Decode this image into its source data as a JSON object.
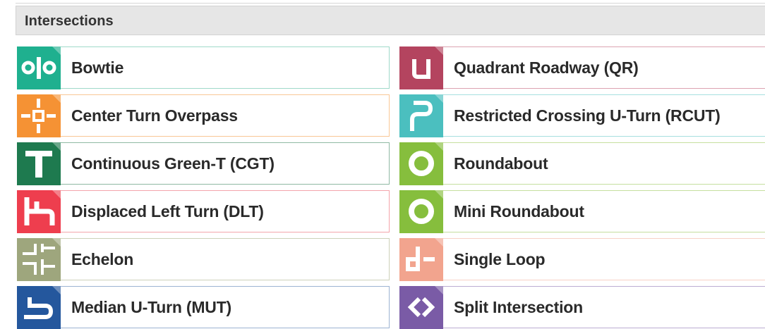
{
  "section": {
    "title": "Intersections"
  },
  "colors": {
    "bowtie": "#1fb08f",
    "center_turn_overpass": "#f59234",
    "continuous_green_t": "#1e7a4f",
    "displaced_left_turn": "#ee3e4e",
    "echelon": "#9ea67d",
    "median_u_turn": "#24579d",
    "quadrant_roadway": "#b4445f",
    "rcut": "#4bbfbf",
    "roundabout": "#86be3d",
    "mini_roundabout": "#86be3d",
    "single_loop": "#f2a48e",
    "split_intersection": "#7a5ba6"
  },
  "intersections": [
    {
      "label": "Bowtie",
      "icon": "bowtie-icon"
    },
    {
      "label": "Center Turn Overpass",
      "icon": "center-turn-overpass-icon"
    },
    {
      "label": "Continuous Green-T (CGT)",
      "icon": "continuous-green-t-icon"
    },
    {
      "label": "Displaced Left Turn (DLT)",
      "icon": "displaced-left-turn-icon"
    },
    {
      "label": "Echelon",
      "icon": "echelon-icon"
    },
    {
      "label": "Median U-Turn (MUT)",
      "icon": "median-u-turn-icon"
    },
    {
      "label": "Quadrant Roadway (QR)",
      "icon": "quadrant-roadway-icon"
    },
    {
      "label": "Restricted Crossing U-Turn (RCUT)",
      "icon": "restricted-crossing-u-turn-icon"
    },
    {
      "label": "Roundabout",
      "icon": "roundabout-icon"
    },
    {
      "label": "Mini Roundabout",
      "icon": "mini-roundabout-icon"
    },
    {
      "label": "Single Loop",
      "icon": "single-loop-icon"
    },
    {
      "label": "Split Intersection",
      "icon": "split-intersection-icon"
    }
  ]
}
